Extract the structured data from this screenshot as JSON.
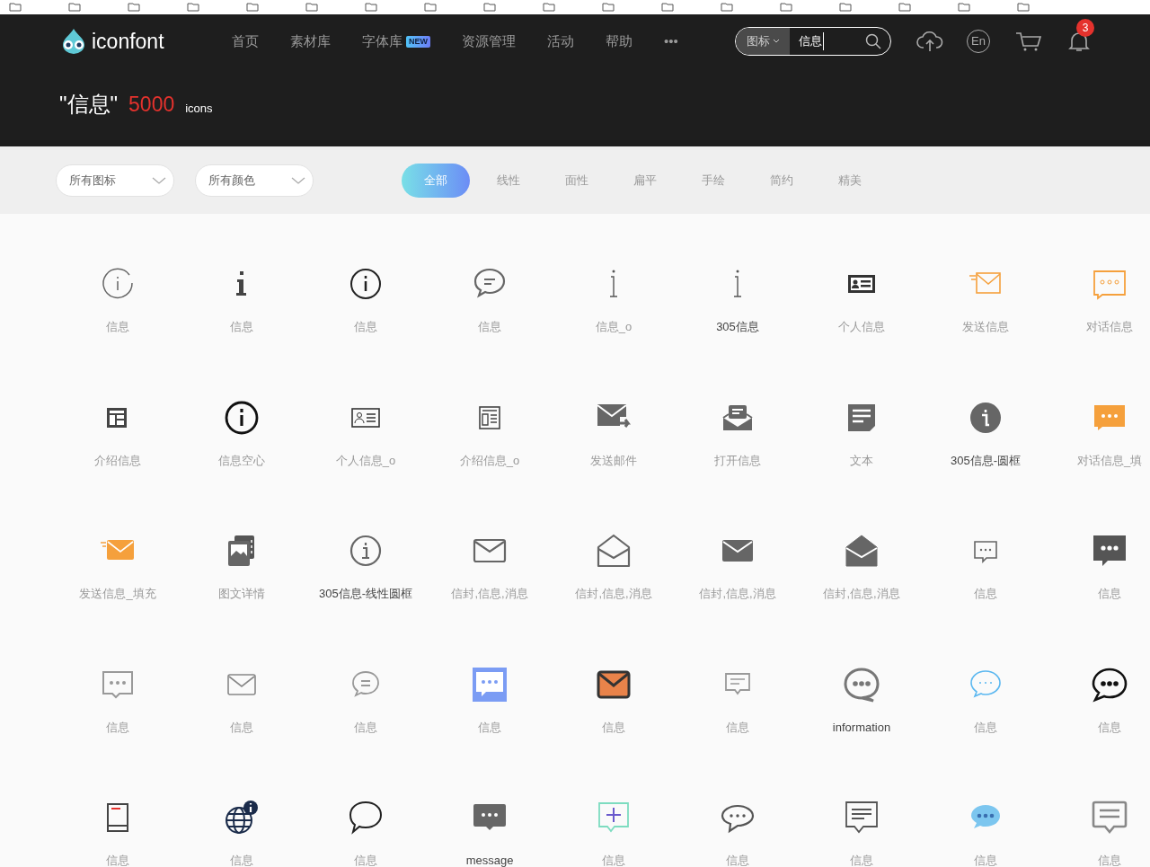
{
  "logo": {
    "text": "iconfont"
  },
  "nav": [
    {
      "label": "首页"
    },
    {
      "label": "素材库"
    },
    {
      "label": "字体库",
      "badge": "NEW"
    },
    {
      "label": "资源管理"
    },
    {
      "label": "活动"
    },
    {
      "label": "帮助"
    },
    {
      "label": "•••"
    }
  ],
  "search": {
    "scope": "图标",
    "value": "信息"
  },
  "header_actions": {
    "language": "En",
    "notifications": "3"
  },
  "result": {
    "query": "\"信息\"",
    "count": "5000",
    "unit": "icons"
  },
  "filters": {
    "dropdowns": [
      "所有图标",
      "所有颜色"
    ],
    "styles": [
      {
        "label": "全部",
        "selected": true
      },
      {
        "label": "线性",
        "selected": false
      },
      {
        "label": "面性",
        "selected": false
      },
      {
        "label": "扁平",
        "selected": false
      },
      {
        "label": "手绘",
        "selected": false
      },
      {
        "label": "简约",
        "selected": false
      },
      {
        "label": "精美",
        "selected": false
      }
    ]
  },
  "icons": [
    {
      "kind": "inforing",
      "name": "信息",
      "dark": false
    },
    {
      "kind": "infoserif",
      "name": "信息",
      "dark": false
    },
    {
      "kind": "infocircle",
      "name": "信息",
      "dark": false
    },
    {
      "kind": "chatlines",
      "name": "信息",
      "dark": false
    },
    {
      "kind": "infothin",
      "name": "信息_o",
      "dark": false
    },
    {
      "kind": "infothin",
      "name": "305信息",
      "dark": true
    },
    {
      "kind": "cardfilled",
      "name": "个人信息",
      "dark": false
    },
    {
      "kind": "sendorange",
      "name": "发送信息",
      "dark": false
    },
    {
      "kind": "dotsorange",
      "name": "对话信息",
      "dark": false
    },
    {
      "kind": "layoutfilled",
      "name": "介绍信息",
      "dark": false
    },
    {
      "kind": "infobold",
      "name": "信息空心",
      "dark": false
    },
    {
      "kind": "cardoutline",
      "name": "个人信息_o",
      "dark": false
    },
    {
      "kind": "layoutoutline",
      "name": "介绍信息_o",
      "dark": false
    },
    {
      "kind": "mailforward",
      "name": "发送邮件",
      "dark": false
    },
    {
      "kind": "mailopenmsg",
      "name": "打开信息",
      "dark": false
    },
    {
      "kind": "docfilled",
      "name": "文本",
      "dark": false
    },
    {
      "kind": "infosolid",
      "name": "305信息-圆框",
      "dark": true
    },
    {
      "kind": "dotsorangefilled",
      "name": "对话信息_填",
      "dark": false
    },
    {
      "kind": "mailorangefilled",
      "name": "发送信息_填充",
      "dark": false
    },
    {
      "kind": "images",
      "name": "图文详情",
      "dark": false
    },
    {
      "kind": "infocirclegray",
      "name": "305信息-线性圆框",
      "dark": true
    },
    {
      "kind": "mailoutline",
      "name": "信封,信息,消息",
      "dark": false
    },
    {
      "kind": "mailopenoutline",
      "name": "信封,信息,消息",
      "dark": false
    },
    {
      "kind": "mailfilled",
      "name": "信封,信息,消息",
      "dark": false
    },
    {
      "kind": "mailopenfilled",
      "name": "信封,信息,消息",
      "dark": false
    },
    {
      "kind": "dotssmall",
      "name": "信息",
      "dark": false
    },
    {
      "kind": "dotsdarkfilled",
      "name": "信息",
      "dark": false
    },
    {
      "kind": "dotsoutline",
      "name": "信息",
      "dark": false
    },
    {
      "kind": "mailthin",
      "name": "信息",
      "dark": false
    },
    {
      "kind": "chatround",
      "name": "信息",
      "dark": false
    },
    {
      "kind": "dotsblueblock",
      "name": "信息",
      "dark": false
    },
    {
      "kind": "mailorangedark",
      "name": "信息",
      "dark": false
    },
    {
      "kind": "chatlinessmall",
      "name": "信息",
      "dark": false
    },
    {
      "kind": "dotsroundbold",
      "name": "information",
      "dark": true
    },
    {
      "kind": "dotsblueoutline",
      "name": "信息",
      "dark": false
    },
    {
      "kind": "dotsblackround",
      "name": "信息",
      "dark": false
    },
    {
      "kind": "tablet",
      "name": "信息",
      "dark": false
    },
    {
      "kind": "globeinfo",
      "name": "信息",
      "dark": false
    },
    {
      "kind": "bubble",
      "name": "信息",
      "dark": false
    },
    {
      "kind": "dotsgrayfilled",
      "name": "message",
      "dark": true
    },
    {
      "kind": "chatplus",
      "name": "信息",
      "dark": false
    },
    {
      "kind": "dotsoval",
      "name": "信息",
      "dark": false
    },
    {
      "kind": "chatlinesoutline",
      "name": "信息",
      "dark": false
    },
    {
      "kind": "dotsbluefilled",
      "name": "信息",
      "dark": false
    },
    {
      "kind": "chatlinesbig",
      "name": "信息",
      "dark": false
    }
  ]
}
